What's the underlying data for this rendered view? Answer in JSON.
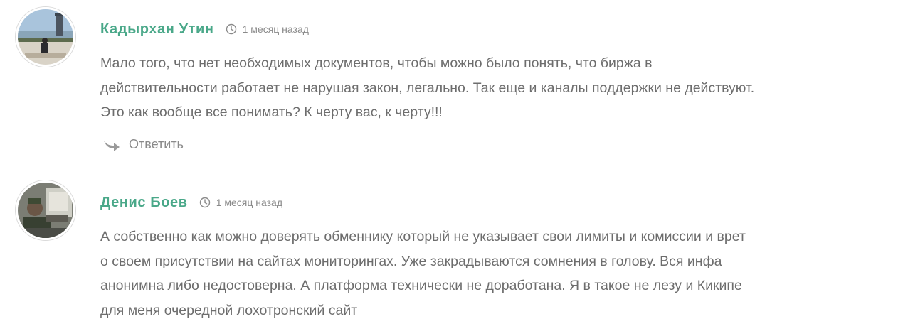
{
  "comments": [
    {
      "author": "Кадырхан Утин",
      "time": "1 месяц назад",
      "lines": [
        "Мало того, что нет необходимых документов, чтобы можно было понять, что биржа в",
        "действительности работает не нарушая закон, легально. Так еще и каналы поддержки не действуют.",
        "Это как вообще все понимать? К черту вас, к черту!!!"
      ],
      "reply_label": "Ответить"
    },
    {
      "author": "Денис Боев",
      "time": "1 месяц назад",
      "lines": [
        "А собственно как можно доверять обменнику который не указывает свои лимиты и комиссии и врет",
        "о своем присутствии на сайтах мониторингах. Уже закрадываются сомнения в голову. Вся инфа",
        "анонимна либо недостоверна. А платформа технически не доработана. Я в такое не лезу и Кикипе",
        "для меня очередной лохотронский сайт"
      ]
    }
  ],
  "icons": {
    "time": "clock-icon",
    "reply": "reply-arrow-icon"
  },
  "colors": {
    "author": "#4aa889",
    "body_text": "#6d6d6d",
    "meta_text": "#8a8a8a"
  }
}
